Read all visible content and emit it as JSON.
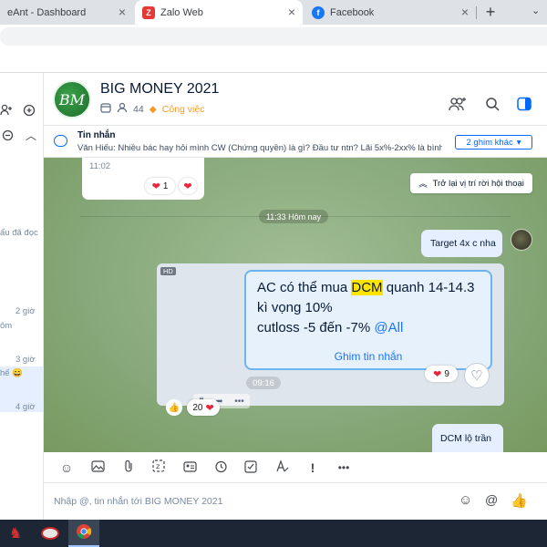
{
  "browser": {
    "tabs": [
      {
        "title": "eAnt - Dashboard",
        "active": false
      },
      {
        "title": "Zalo Web",
        "active": true
      },
      {
        "title": "Facebook",
        "active": false
      }
    ],
    "new_tab": "+",
    "close": "×",
    "chevron": "⌄"
  },
  "sidebar": {
    "snippets": [
      "ấu đã đọc",
      "2 giờ",
      "ôm",
      "3 giờ",
      "hế 😄",
      "4 giờ"
    ]
  },
  "header": {
    "avatar_text": "BM",
    "group_name": "BIG MONEY 2021",
    "member_count": "44",
    "tag_label": "Công việc"
  },
  "pinned": {
    "title": "Tin nhắn",
    "text": "Văn Hiếu: Nhiều bác hay hỏi mình CW (Chứng quyền) là gì? Đầu tư ntn? Lãi 5x%-2xx% là bình thư...",
    "more_button": "2 ghim khác"
  },
  "chat": {
    "prev_time": "11:02",
    "prev_reaction_count": "1",
    "back_button": "Trở lại vị trí rời hội thoại",
    "day_divider": "11:33 Hôm nay",
    "msg_target": "Target 4x c nha",
    "card": {
      "hd": "HD",
      "line1_pre": "AC có thể mua ",
      "line1_highlight": "DCM",
      "line1_post": " quanh 14-14.3",
      "line2": "kì vọng 10%",
      "line3_pre": "cutloss -5 đến -7% ",
      "line3_mention": "@All",
      "pin_link": "Ghim tin nhắn",
      "time": "09:16",
      "reaction_count": "9",
      "bottom_reaction_count": "20"
    },
    "msg_dcm": "DCM lộ trần"
  },
  "composer": {
    "placeholder": "Nhập @, tin nhắn tới BIG MONEY 2021"
  },
  "colors": {
    "accent": "#0068ff",
    "tag": "#f59b2b",
    "highlight": "#ffe400",
    "chat_bg": "#8fae82"
  }
}
